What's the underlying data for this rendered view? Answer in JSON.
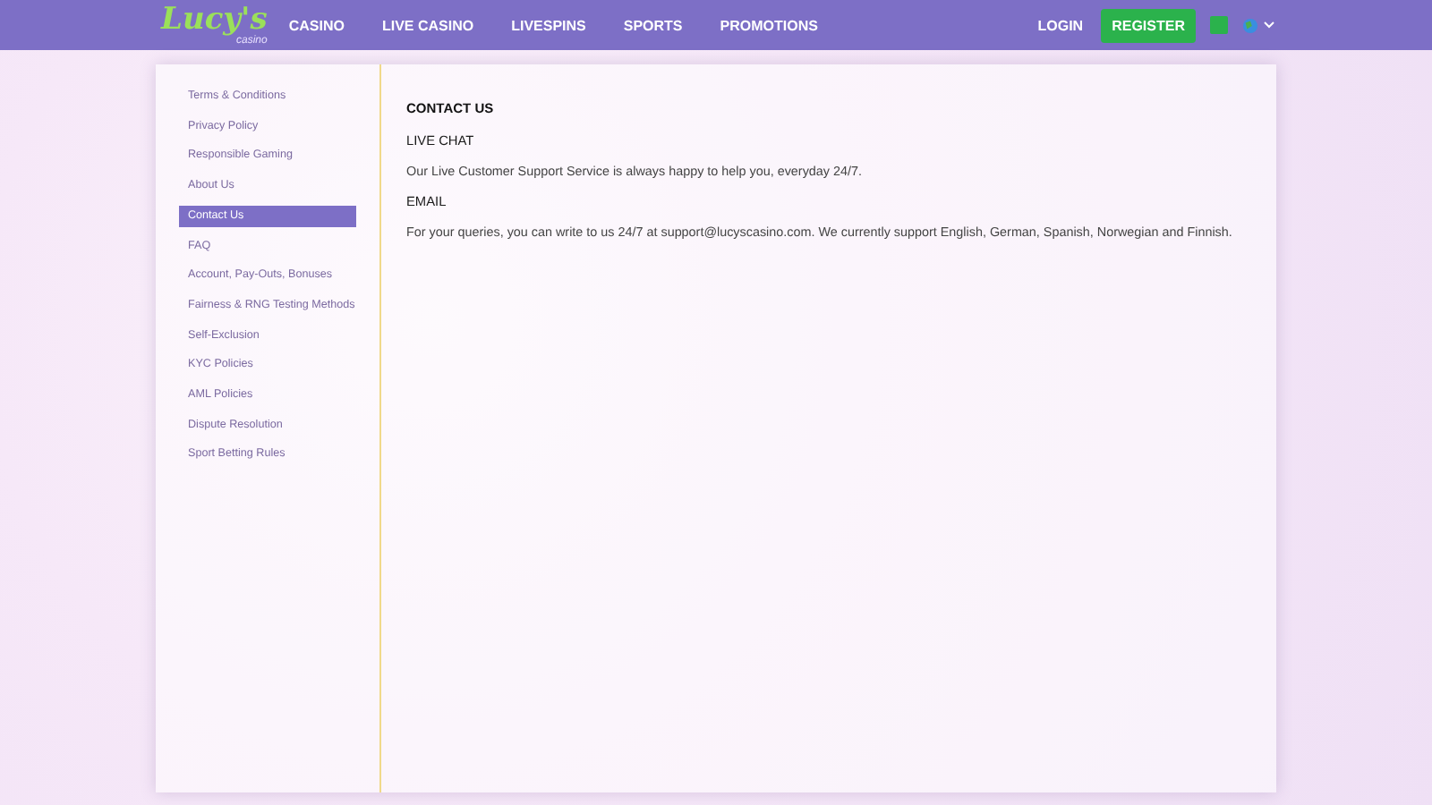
{
  "header": {
    "logo": {
      "title": "Lucy's",
      "subtitle": "casino"
    },
    "nav": [
      {
        "label": "CASINO"
      },
      {
        "label": "LIVE CASINO"
      },
      {
        "label": "LIVESPINS"
      },
      {
        "label": "SPORTS"
      },
      {
        "label": "PROMOTIONS"
      }
    ],
    "login": "LOGIN",
    "register": "REGISTER"
  },
  "sidebar": {
    "items": [
      {
        "label": "Terms & Conditions",
        "selected": false
      },
      {
        "label": "Privacy Policy",
        "selected": false
      },
      {
        "label": "Responsible Gaming",
        "selected": false
      },
      {
        "label": "About Us",
        "selected": false
      },
      {
        "label": "Contact Us",
        "selected": true
      },
      {
        "label": "FAQ",
        "selected": false
      },
      {
        "label": "Account, Pay-Outs, Bonuses",
        "selected": false
      },
      {
        "label": "Fairness & RNG Testing Methods",
        "selected": false
      },
      {
        "label": "Self-Exclusion",
        "selected": false
      },
      {
        "label": "KYC Policies",
        "selected": false
      },
      {
        "label": "AML Policies",
        "selected": false
      },
      {
        "label": "Dispute Resolution",
        "selected": false
      },
      {
        "label": "Sport Betting Rules",
        "selected": false
      }
    ]
  },
  "content": {
    "title": "CONTACT US",
    "blocks": [
      {
        "kind": "heading",
        "text": "LIVE CHAT"
      },
      {
        "kind": "paragraph",
        "text": "Our Live Customer Support Service is always happy to help you, everyday 24/7."
      },
      {
        "kind": "heading",
        "text": "EMAIL"
      },
      {
        "kind": "paragraph",
        "text": "For your queries, you can write to us 24/7 at support@lucyscasino.com. We currently support English, German, Spanish, Norwegian and Finnish."
      }
    ]
  }
}
